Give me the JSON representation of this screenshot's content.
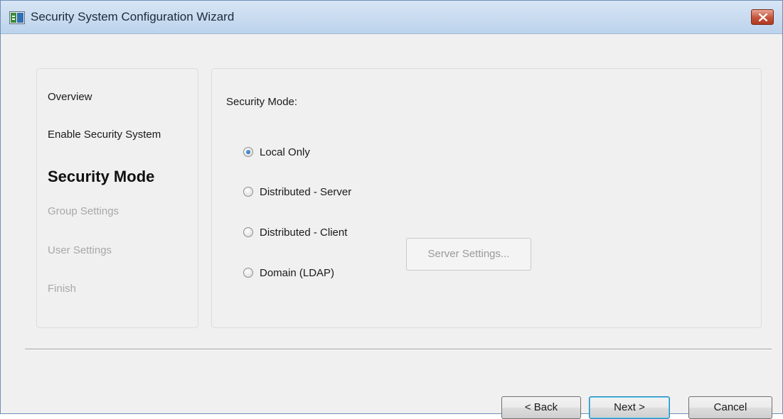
{
  "window": {
    "title": "Security System Configuration Wizard"
  },
  "nav": {
    "items": [
      {
        "label": "Overview",
        "state": "done"
      },
      {
        "label": "Enable Security System",
        "state": "done"
      },
      {
        "label": "Security Mode",
        "state": "current"
      },
      {
        "label": "Group Settings",
        "state": "disabled"
      },
      {
        "label": "User Settings",
        "state": "disabled"
      },
      {
        "label": "Finish",
        "state": "disabled"
      }
    ]
  },
  "content": {
    "section_label": "Security Mode:",
    "options": [
      {
        "label": "Local Only",
        "checked": true
      },
      {
        "label": "Distributed - Server",
        "checked": false
      },
      {
        "label": "Distributed - Client",
        "checked": false
      },
      {
        "label": "Domain (LDAP)",
        "checked": false
      }
    ],
    "server_settings_label": "Server Settings..."
  },
  "footer": {
    "back_label": "< Back",
    "next_label": "Next >",
    "cancel_label": "Cancel"
  },
  "colors": {
    "title_bar": "#bcd3ec",
    "close_button": "#c4523a",
    "disabled_text": "#a8a8a8",
    "radio_selected": "#1c5aa6"
  },
  "icons": {
    "app": "wizard-app-icon",
    "close": "close-icon"
  }
}
